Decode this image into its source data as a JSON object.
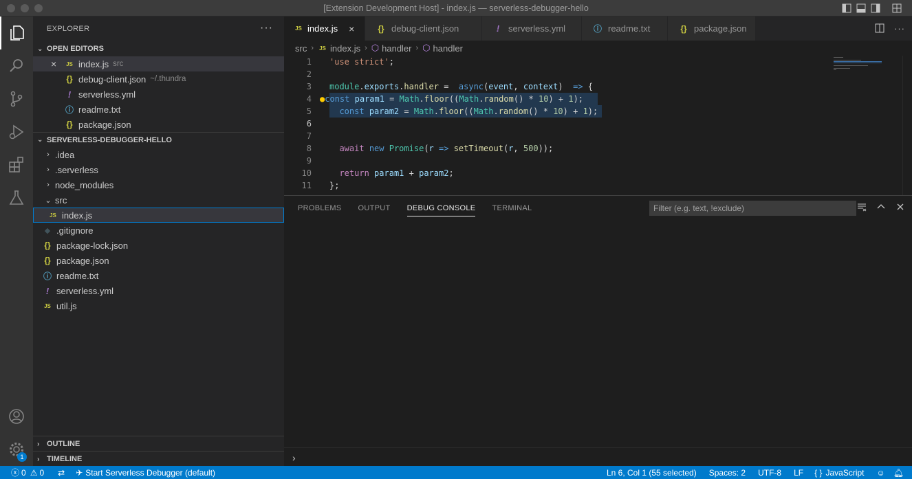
{
  "window": {
    "title": "[Extension Development Host] - index.js — serverless-debugger-hello"
  },
  "activity": {
    "accounts_badge": "1"
  },
  "sidebar": {
    "title": "EXPLORER",
    "more": "···",
    "open_editors": {
      "header": "OPEN EDITORS",
      "items": [
        {
          "icon": "JS",
          "name": "index.js",
          "desc": "src"
        },
        {
          "icon": "{}",
          "name": "debug-client.json",
          "desc": "~/.thundra"
        },
        {
          "icon": "!",
          "name": "serverless.yml",
          "desc": ""
        },
        {
          "icon": "ⓘ",
          "name": "readme.txt",
          "desc": ""
        },
        {
          "icon": "{}",
          "name": "package.json",
          "desc": ""
        }
      ]
    },
    "project": {
      "header": "SERVERLESS-DEBUGGER-HELLO",
      "items": [
        {
          "kind": "folder",
          "name": ".idea",
          "expanded": false
        },
        {
          "kind": "folder",
          "name": ".serverless",
          "expanded": false
        },
        {
          "kind": "folder",
          "name": "node_modules",
          "expanded": false
        },
        {
          "kind": "folder",
          "name": "src",
          "expanded": true
        },
        {
          "kind": "file",
          "icon": "JS",
          "name": "index.js",
          "indent": 1
        },
        {
          "kind": "file",
          "icon": "◆",
          "name": ".gitignore"
        },
        {
          "kind": "file",
          "icon": "{}",
          "name": "package-lock.json"
        },
        {
          "kind": "file",
          "icon": "{}",
          "name": "package.json"
        },
        {
          "kind": "file",
          "icon": "ⓘ",
          "name": "readme.txt"
        },
        {
          "kind": "file",
          "icon": "!",
          "name": "serverless.yml"
        },
        {
          "kind": "file",
          "icon": "JS",
          "name": "util.js"
        }
      ]
    },
    "outline": "OUTLINE",
    "timeline": "TIMELINE"
  },
  "editor": {
    "tabs": [
      {
        "icon": "JS",
        "label": "index.js",
        "close": "×"
      },
      {
        "icon": "{}",
        "label": "debug-client.json"
      },
      {
        "icon": "!",
        "label": "serverless.yml"
      },
      {
        "icon": "ⓘ",
        "label": "readme.txt"
      },
      {
        "icon": "{}",
        "label": "package.json"
      }
    ],
    "breadcrumbs": [
      "src",
      "index.js",
      "handler",
      "handler"
    ],
    "breadcrumb_icons": [
      "JS",
      "⬡",
      "⬡"
    ],
    "line_numbers": [
      "1",
      "2",
      "3",
      "4",
      "5",
      "6",
      "7",
      "8",
      "9",
      "10",
      "11"
    ]
  },
  "panel": {
    "tabs": [
      "PROBLEMS",
      "OUTPUT",
      "DEBUG CONSOLE",
      "TERMINAL"
    ],
    "active_tab": "DEBUG CONSOLE",
    "filter_placeholder": "Filter (e.g. text, !exclude)",
    "prompt": "›"
  },
  "status": {
    "errors": "0",
    "warnings": "0",
    "debug_target": "Start Serverless Debugger (default)",
    "cursor": "Ln 6, Col 1 (55 selected)",
    "spaces": "Spaces: 2",
    "encoding": "UTF-8",
    "eol": "LF",
    "language": "JavaScript",
    "language_icon": "{ }"
  },
  "colors": {
    "status_bar": "#007acc",
    "activity_bar": "#333333",
    "sidebar": "#252526",
    "editor": "#1e1e1e",
    "selection": "#264f78"
  }
}
